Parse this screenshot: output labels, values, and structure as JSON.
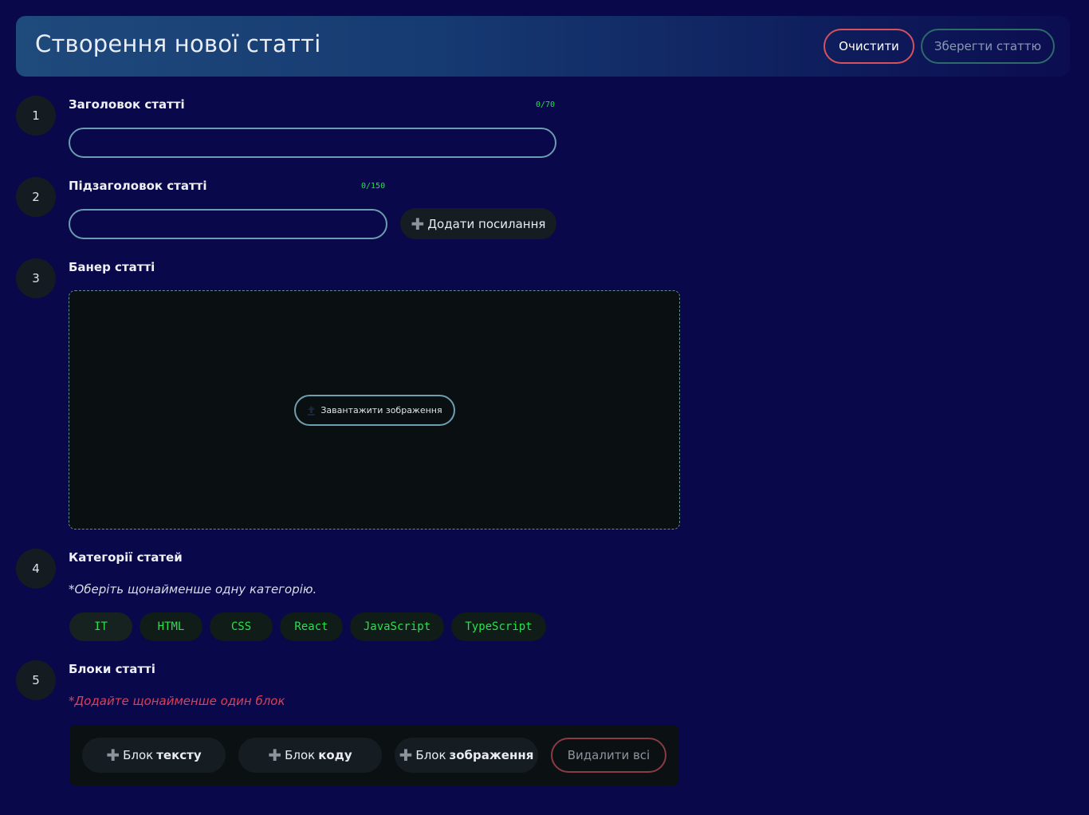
{
  "header": {
    "title": "Створення нової статті",
    "clear_label": "Очистити",
    "save_label": "Зберегти статтю"
  },
  "steps": [
    {
      "number": "1",
      "label": "Заголовок статті",
      "counter": "0/70",
      "input_value": ""
    },
    {
      "number": "2",
      "label": "Підзаголовок статті",
      "counter": "0/150",
      "input_value": "",
      "add_link_label": "Додати посилання"
    },
    {
      "number": "3",
      "label": "Банер статті",
      "upload_label": "Завантажити зображення"
    },
    {
      "number": "4",
      "label": "Категорії статей",
      "hint": "*Оберіть щонайменше одну категорію.",
      "categories": [
        "IT",
        "HTML",
        "CSS",
        "React",
        "JavaScript",
        "TypeScript"
      ]
    },
    {
      "number": "5",
      "label": "Блоки статті",
      "hint": "*Додайте щонайменше один блок",
      "blocks": [
        {
          "prefix": "Блок ",
          "bold": "тексту"
        },
        {
          "prefix": "Блок ",
          "bold": "коду"
        },
        {
          "prefix": "Блок ",
          "bold": "зображення"
        }
      ],
      "delete_all_label": "Видалити всі"
    }
  ],
  "icons": {
    "plus": "plus-icon",
    "upload": "upload-icon"
  },
  "colors": {
    "background": "#08084a",
    "accent_green": "#23e04a",
    "danger": "#d4525c",
    "hint_error": "#d9405a"
  }
}
